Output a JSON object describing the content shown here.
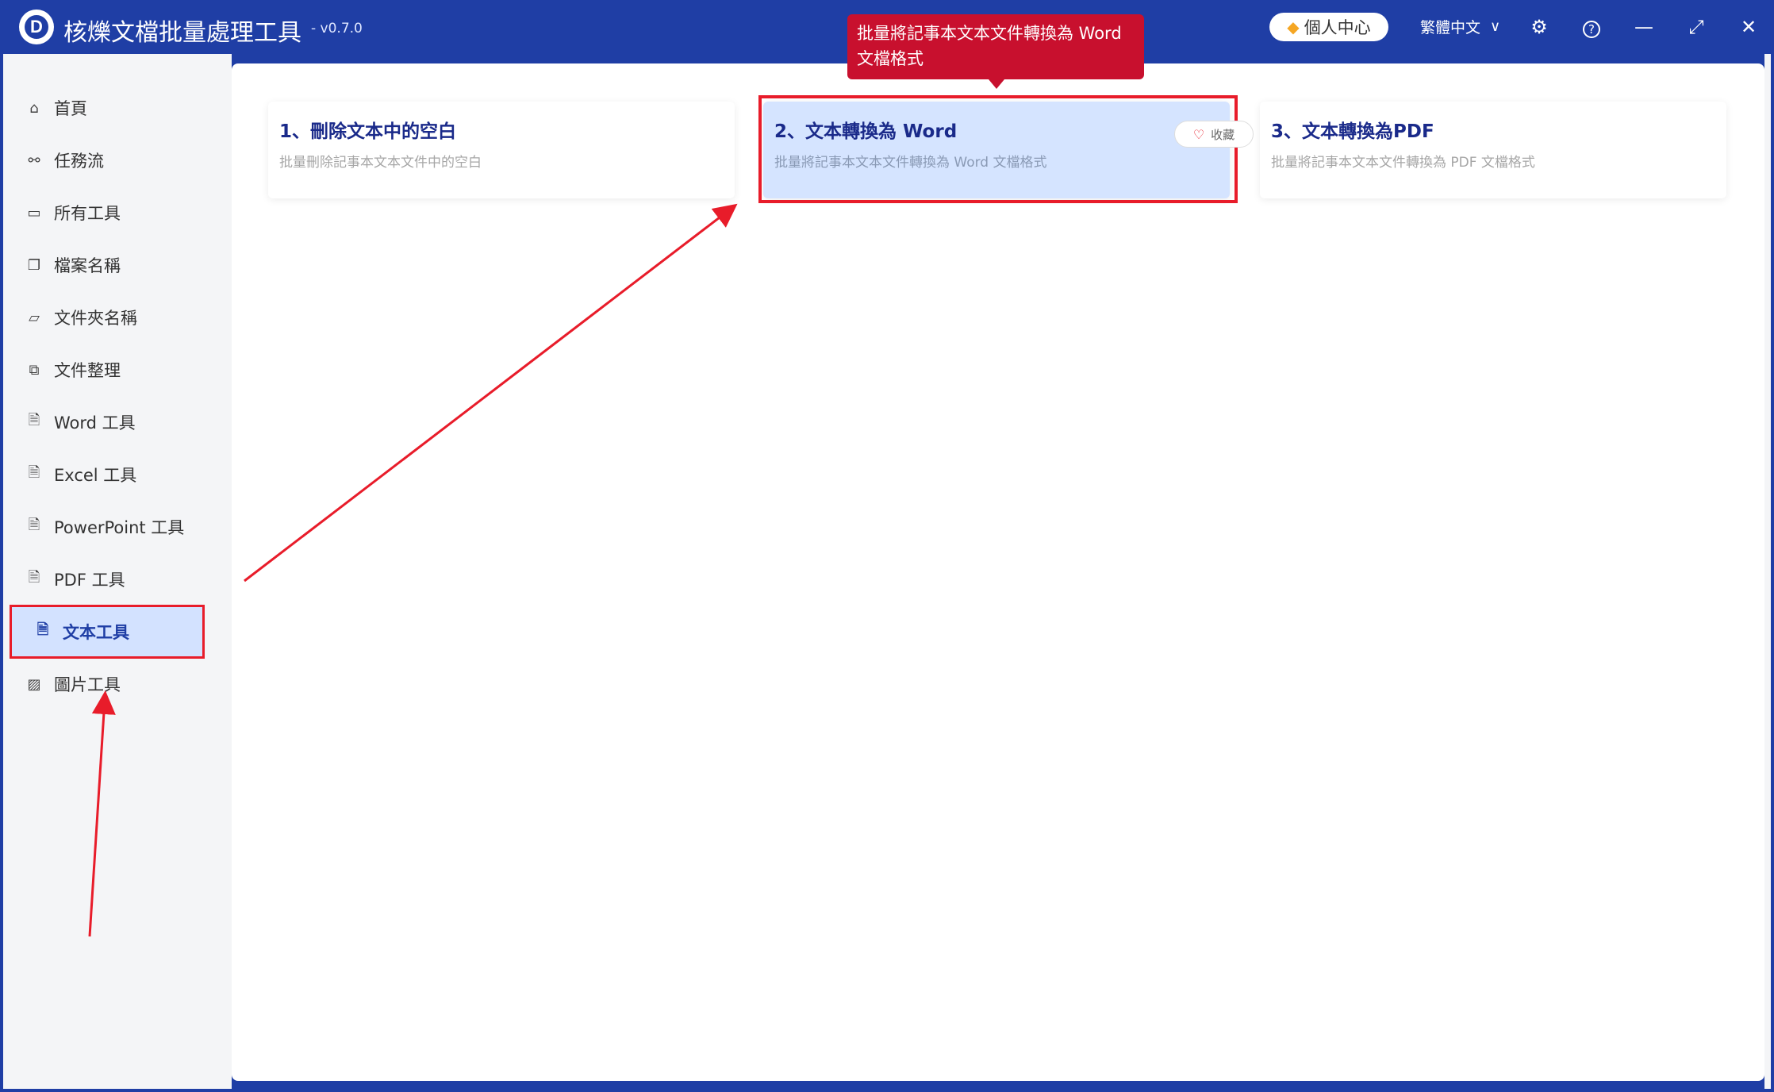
{
  "app": {
    "title": "核爍文檔批量處理工具",
    "version": "- v0.7.0"
  },
  "titlebar": {
    "vip_label": "個人中心",
    "language": "繁體中文"
  },
  "sidebar": {
    "items": [
      {
        "label": "首頁",
        "icon": "home-icon"
      },
      {
        "label": "任務流",
        "icon": "workflow-icon"
      },
      {
        "label": "所有工具",
        "icon": "monitor-icon"
      },
      {
        "label": "檔案名稱",
        "icon": "file-name-icon"
      },
      {
        "label": "文件夾名稱",
        "icon": "folder-icon"
      },
      {
        "label": "文件整理",
        "icon": "organize-icon"
      },
      {
        "label": "Word 工具",
        "icon": "word-file-icon"
      },
      {
        "label": "Excel 工具",
        "icon": "excel-file-icon"
      },
      {
        "label": "PowerPoint 工具",
        "icon": "ppt-file-icon"
      },
      {
        "label": "PDF 工具",
        "icon": "pdf-file-icon"
      },
      {
        "label": "文本工具",
        "icon": "text-file-icon",
        "active": true
      },
      {
        "label": "圖片工具",
        "icon": "image-icon"
      }
    ]
  },
  "cards": [
    {
      "title": "1、刪除文本中的空白",
      "desc": "批量刪除記事本文本文件中的空白"
    },
    {
      "title": "2、文本轉換為 Word",
      "desc": "批量將記事本文本文件轉換為 Word 文檔格式"
    },
    {
      "title": "3、文本轉換為PDF",
      "desc": "批量將記事本文本文件轉換為 PDF 文檔格式"
    }
  ],
  "favorite_label": "收藏",
  "tooltip": "批量將記事本文本文件轉換為 Word 文檔格式",
  "colors": {
    "brand": "#1f3ea5",
    "highlight": "#e81c2a",
    "active_bg": "#d3e2ff",
    "tooltip_bg": "#c8102e"
  }
}
